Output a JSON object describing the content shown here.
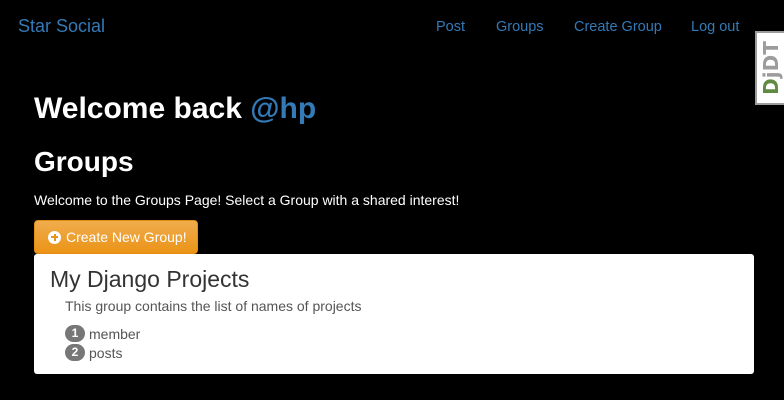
{
  "navbar": {
    "brand": "Star Social",
    "links": [
      "Post",
      "Groups",
      "Create Group",
      "Log out"
    ]
  },
  "debug_toolbar": {
    "label_d": "D",
    "label_rest": "jDT"
  },
  "main": {
    "welcome_prefix": "Welcome back",
    "username": "@hp",
    "groups_title": "Groups",
    "groups_description": "Welcome to the Groups Page! Select a Group with a shared interest!",
    "create_button_label": "Create New Group!",
    "create_button_icon": "plus-circle-icon"
  },
  "groups": [
    {
      "name": "My Django Projects",
      "description": "This group contains the list of names of projects",
      "member_count": "1",
      "member_label": "member",
      "post_count": "2",
      "post_label": "posts"
    }
  ],
  "colors": {
    "background": "#000000",
    "link": "#337ab7",
    "button": "#f0ad4e",
    "badge": "#777777"
  }
}
